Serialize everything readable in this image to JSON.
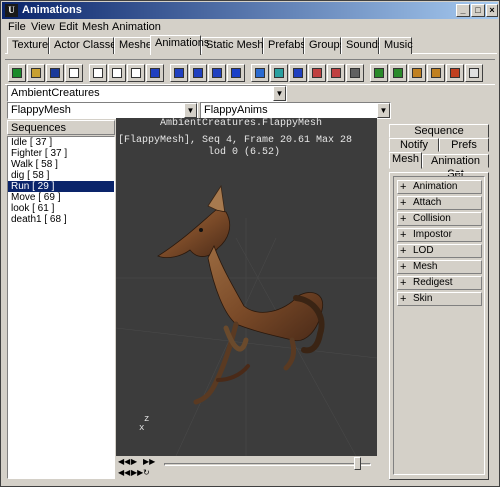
{
  "window": {
    "title": "Animations",
    "app_icon_text": "U"
  },
  "menu": [
    "File",
    "View",
    "Edit",
    "Mesh",
    "Animation"
  ],
  "tabs": [
    "Textures",
    "Actor Classes",
    "Meshes",
    "Animations",
    "Static Meshes",
    "Prefabs",
    "Groups",
    "Sounds",
    "Music"
  ],
  "active_tab": "Animations",
  "toolbar": {
    "icons": [
      "new-icon",
      "open-icon",
      "save-icon",
      "copy-icon",
      "edit-icon",
      "edit2-icon",
      "edit3-icon",
      "link-icon",
      "info-icon",
      "browse-icon",
      "browse2-icon",
      "mesh-icon",
      "wire-icon",
      "grid-icon",
      "skeleton-icon",
      "bones-icon",
      "pivot-icon",
      "normals-icon",
      "export-icon",
      "import-icon",
      "key-icon",
      "lock-icon",
      "tag-icon",
      "sound-icon"
    ]
  },
  "package_combo": {
    "value": "AmbientCreatures"
  },
  "mesh_combo": {
    "value": "FlappyMesh"
  },
  "anim_combo": {
    "value": "FlappyAnims"
  },
  "sequences": {
    "header": "Sequences",
    "items": [
      "Idle [ 37 ]",
      "Fighter [ 37 ]",
      "Walk [ 58 ]",
      "dig [ 58 ]",
      "Run [ 29 ]",
      "Move [ 69 ]",
      "look [ 61 ]",
      "death1 [ 68 ]"
    ],
    "selected_index": 4
  },
  "viewport": {
    "title": "AmbientCreatures.FlappyMesh",
    "info_line": "[FlappyMesh], Seq 4,  Frame 20.61 Max 28",
    "lod_line": "lod 0 (6.52)",
    "axis_z": "z",
    "axis_x": "x"
  },
  "playback": {
    "position_fraction": 0.95
  },
  "right_tabs": {
    "row1": [
      "Sequence"
    ],
    "row2": [
      "Notify",
      "Prefs"
    ],
    "row3": [
      "Mesh",
      "Animation Set"
    ],
    "active": "Mesh"
  },
  "properties": [
    "Animation",
    "Attach",
    "Collision",
    "Impostor",
    "LOD",
    "Mesh",
    "Redigest",
    "Skin"
  ],
  "colors": {
    "selection": "#0a246a",
    "viewport_bg": "#3c3c3c",
    "title_gradient_start": "#0a246a",
    "title_gradient_end": "#a6caf0"
  }
}
